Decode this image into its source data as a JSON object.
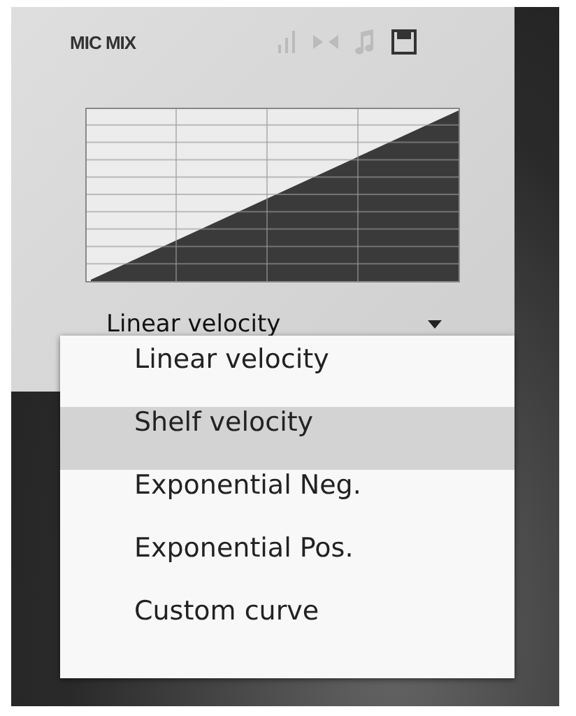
{
  "panel": {
    "title": "MIC MIX",
    "curve_select": {
      "value": "Linear velocity"
    }
  },
  "menu": {
    "items": [
      {
        "label": "Linear velocity",
        "selected": false
      },
      {
        "label": "Shelf velocity",
        "selected": true
      },
      {
        "label": "Exponential Neg.",
        "selected": false
      },
      {
        "label": "Exponential Pos.",
        "selected": false
      },
      {
        "label": "Custom curve",
        "selected": false
      }
    ]
  }
}
